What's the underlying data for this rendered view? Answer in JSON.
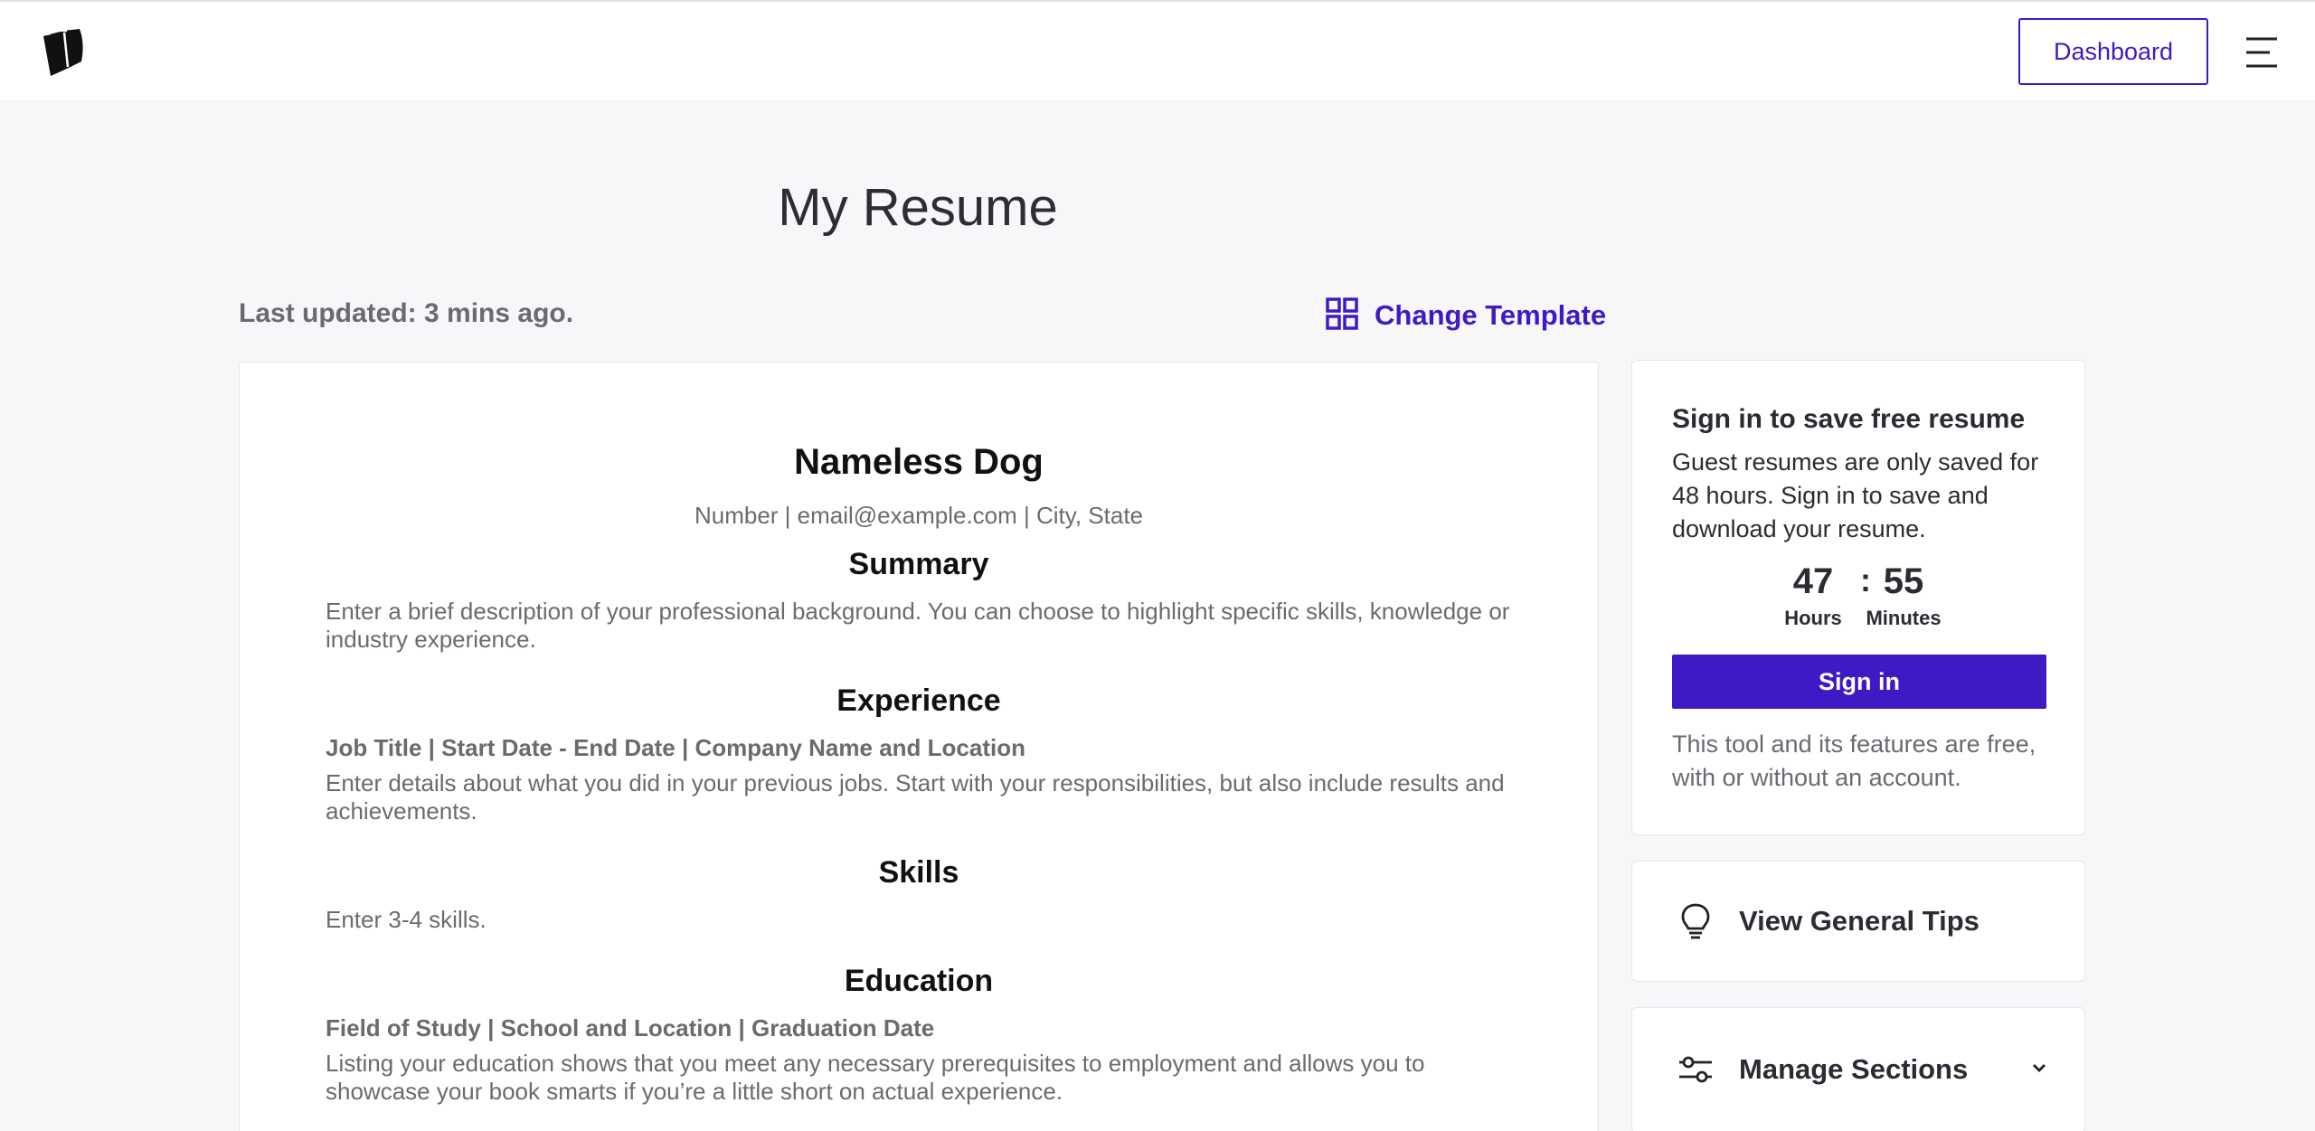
{
  "header": {
    "logo_icon": "book-logo-icon",
    "dashboard_label": "Dashboard",
    "menu_icon": "hamburger-menu-icon"
  },
  "page": {
    "title": "My Resume",
    "last_updated": "Last updated: 3 mins ago.",
    "change_template_label": "Change Template",
    "change_template_icon": "grid-layout-icon"
  },
  "resume": {
    "name": "Nameless Dog",
    "contact": "Number | email@example.com | City, State",
    "sections": {
      "summary": {
        "heading": "Summary",
        "body": "Enter a brief description of your professional background. You can choose to highlight specific skills, knowledge or industry experience."
      },
      "experience": {
        "heading": "Experience",
        "subheading": "Job Title | Start Date - End Date | Company Name and Location",
        "body": "Enter details about what you did in your previous jobs. Start with your responsibilities, but also include results and achievements."
      },
      "skills": {
        "heading": "Skills",
        "body": "Enter 3-4 skills."
      },
      "education": {
        "heading": "Education",
        "subheading": "Field of Study | School and Location | Graduation Date",
        "body": "Listing your education shows that you meet any necessary prerequisites to employment and allows you to showcase your book smarts if you’re a little short on actual experience."
      }
    }
  },
  "signin_card": {
    "title": "Sign in to save free resume",
    "body": "Guest resumes are only saved for 48 hours. Sign in to save and download your resume.",
    "timer": {
      "hours": "47",
      "separator": ":",
      "minutes": "55",
      "hours_label": "Hours",
      "minutes_label": "Minutes"
    },
    "button_label": "Sign in",
    "note": "This tool and its features are free, with or without an account."
  },
  "tips": {
    "label": "View General Tips",
    "icon": "lightbulb-icon"
  },
  "manage_sections": {
    "label": "Manage Sections",
    "icon": "sliders-icon",
    "toggle_icon": "chevron-down-icon"
  },
  "colors": {
    "accent": "#3f1ac4",
    "background": "#f7f7f9",
    "muted_text": "#6b6b6b"
  }
}
